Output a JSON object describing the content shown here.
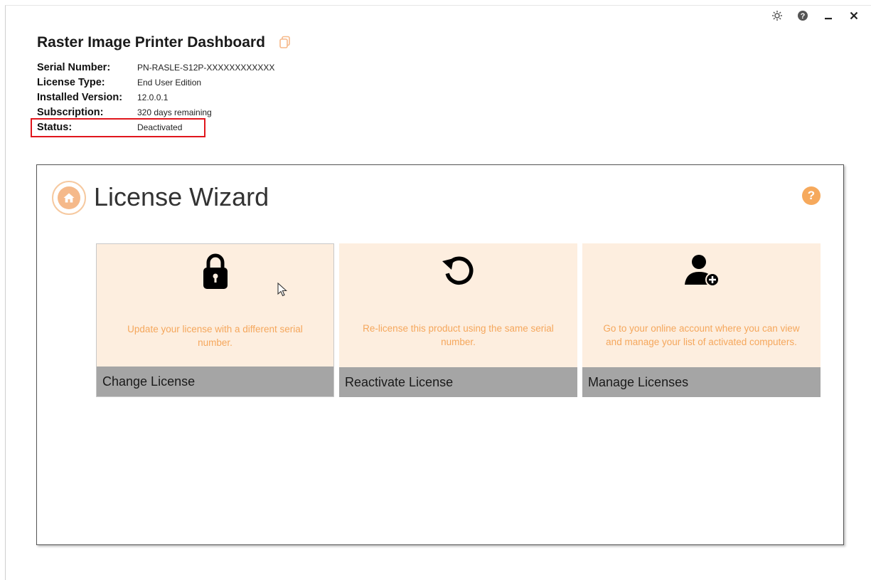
{
  "window": {
    "controls": [
      {
        "name": "settings",
        "icon": "gear-icon"
      },
      {
        "name": "help",
        "icon": "question-circle-icon"
      },
      {
        "name": "minimize",
        "icon": "minimize-icon"
      },
      {
        "name": "close",
        "icon": "close-icon"
      }
    ]
  },
  "header": {
    "title": "Raster Image Printer Dashboard",
    "title_icon": "copy-icon"
  },
  "info": {
    "serial_label": "Serial Number:",
    "serial_value": "PN-RASLE-S12P-XXXXXXXXXXXX",
    "license_type_label": "License Type:",
    "license_type_value": "End User Edition",
    "version_label": "Installed Version:",
    "version_value": "12.0.0.1",
    "subscription_label": "Subscription:",
    "subscription_value": "320 days remaining",
    "status_label": "Status:",
    "status_value": "Deactivated"
  },
  "wizard": {
    "title": "License Wizard",
    "home_icon": "home-icon",
    "help_text": "?",
    "cards": [
      {
        "label": "Change License",
        "description": "Update your license with a different serial number.",
        "icon": "lock-icon"
      },
      {
        "label": "Reactivate License",
        "description": "Re-license this product using the same serial number.",
        "icon": "refresh-icon"
      },
      {
        "label": "Manage Licenses",
        "description": "Go to your online account where you can view and manage your list of activated computers.",
        "icon": "user-add-icon"
      }
    ]
  },
  "colors": {
    "accent": "#f6a95c",
    "card_bg": "#fdeedf",
    "card_footer": "#a5a5a5",
    "highlight": "#e0161c"
  }
}
